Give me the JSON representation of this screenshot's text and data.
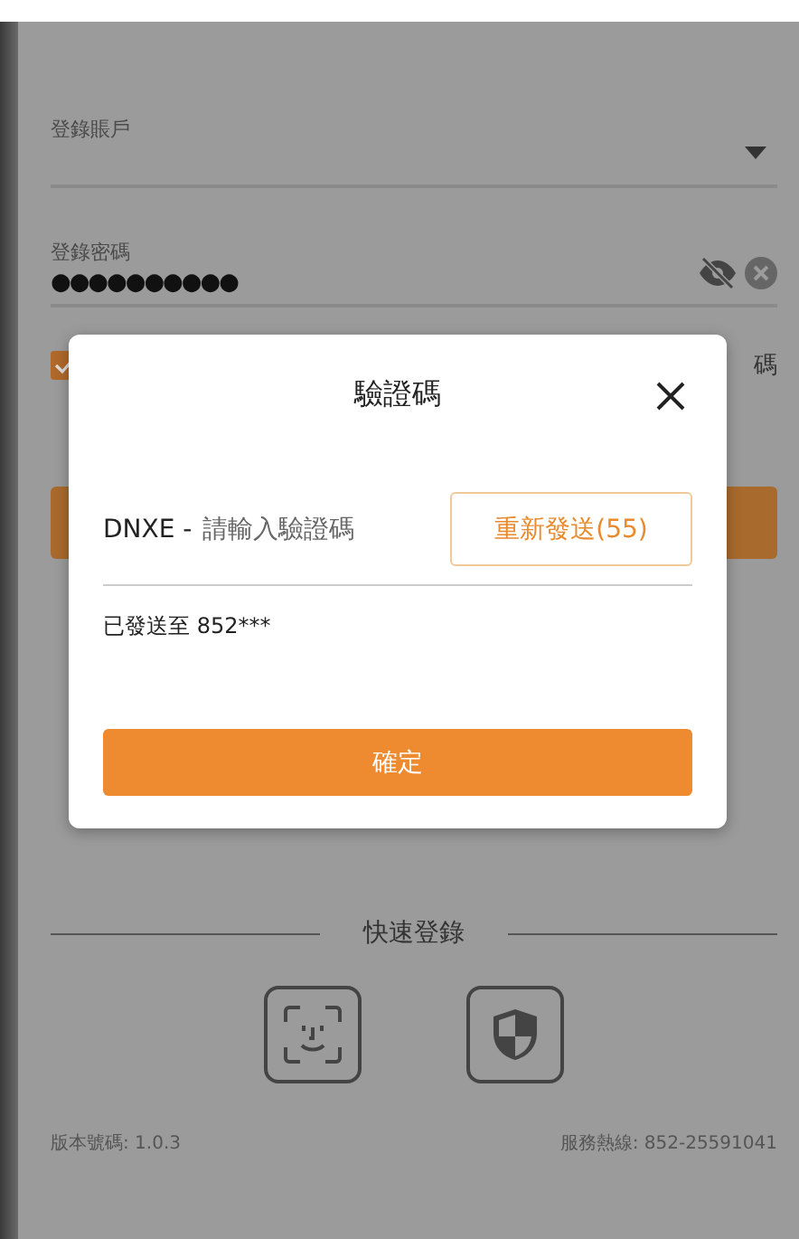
{
  "account_field": {
    "label": "登錄賬戶"
  },
  "password_field": {
    "label": "登錄密碼",
    "value": "●●●●●●●●●●"
  },
  "remember": {
    "checked": true,
    "side_label": "碼"
  },
  "dialog": {
    "title": "驗證碼",
    "code_prefix": "DNXE -",
    "placeholder": "請輸入驗證碼",
    "resend_button": "重新發送(55)",
    "sent_to": "已發送至 852***",
    "confirm_button": "確定"
  },
  "quick_login": {
    "title": "快速登錄"
  },
  "footer": {
    "version": "版本號碼: 1.0.3",
    "hotline": "服務熱線: 852-25591041"
  }
}
